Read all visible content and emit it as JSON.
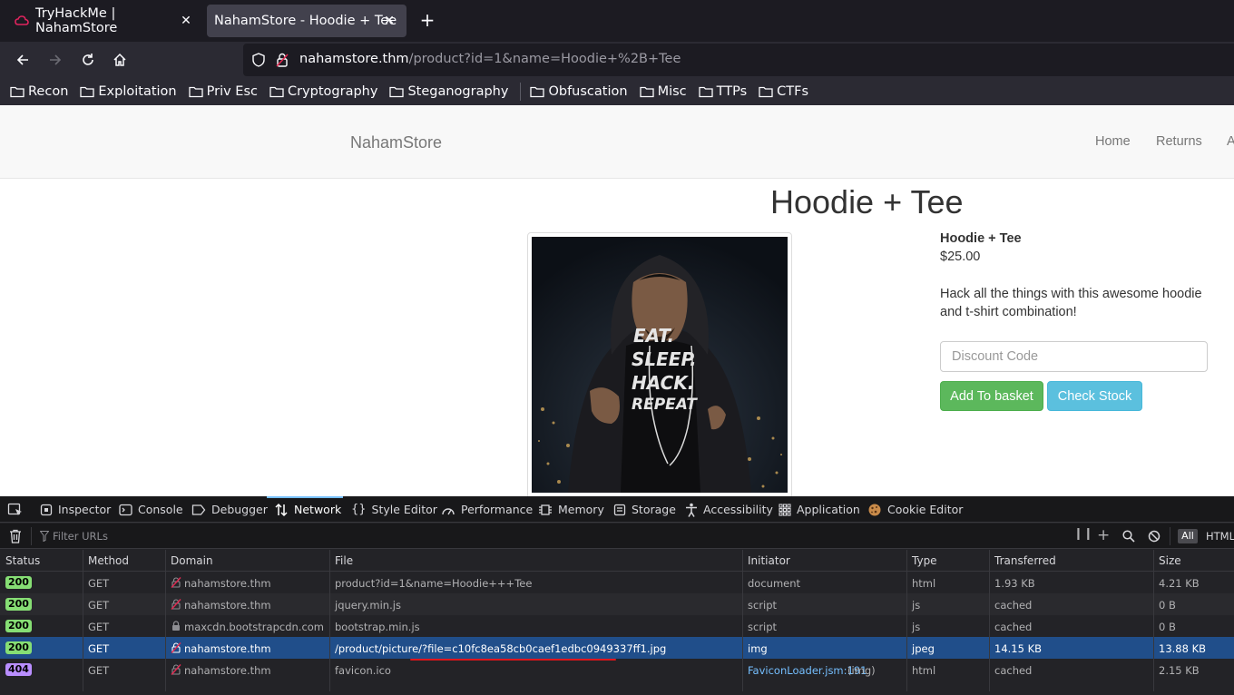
{
  "browser": {
    "tabs": [
      {
        "title": "TryHackMe | NahamStore",
        "active": false
      },
      {
        "title": "NahamStore - Hoodie + Tee",
        "active": true
      }
    ],
    "url": {
      "host": "nahamstore.thm",
      "path": "/product?id=1&name=Hoodie+%2B+Tee"
    },
    "bookmarks": [
      "Recon",
      "Exploitation",
      "Priv Esc",
      "Cryptography",
      "Steganography",
      "Obfuscation",
      "Misc",
      "TTPs",
      "CTFs"
    ]
  },
  "site": {
    "brand": "NahamStore",
    "nav": [
      "Home",
      "Returns",
      "A"
    ],
    "product": {
      "heading": "Hoodie + Tee",
      "name": "Hoodie + Tee",
      "price": "$25.00",
      "description": "Hack all the things with this awesome hoodie and t-shirt combination!",
      "shirt_text": [
        "EAT.",
        "SLEEP.",
        "HACK.",
        "REPEAT"
      ],
      "discount_placeholder": "Discount Code",
      "add_button": "Add To basket",
      "stock_button": "Check Stock"
    }
  },
  "devtools": {
    "tabs": [
      "Inspector",
      "Console",
      "Debugger",
      "Network",
      "Style Editor",
      "Performance",
      "Memory",
      "Storage",
      "Accessibility",
      "Application",
      "Cookie Editor"
    ],
    "active_tab": "Network",
    "filter_placeholder": "Filter URLs",
    "filter_all": "All",
    "filter_html": "HTML",
    "columns": [
      "Status",
      "Method",
      "Domain",
      "File",
      "Initiator",
      "Type",
      "Transferred",
      "Size"
    ],
    "rows": [
      {
        "status": "200",
        "method": "GET",
        "domain": "nahamstore.thm",
        "file": "product?id=1&name=Hoodie+++Tee",
        "initiator": "document",
        "initiator_extra": "",
        "type": "html",
        "transferred": "1.93 KB",
        "size": "4.21 KB"
      },
      {
        "status": "200",
        "method": "GET",
        "domain": "nahamstore.thm",
        "file": "jquery.min.js",
        "initiator": "script",
        "initiator_extra": "",
        "type": "js",
        "transferred": "cached",
        "size": "0 B"
      },
      {
        "status": "200",
        "method": "GET",
        "domain": "maxcdn.bootstrapcdn.com",
        "file": "bootstrap.min.js",
        "initiator": "script",
        "initiator_extra": "",
        "type": "js",
        "transferred": "cached",
        "size": "0 B"
      },
      {
        "status": "200",
        "method": "GET",
        "domain": "nahamstore.thm",
        "file": "/product/picture/?file=c10fc8ea58cb0caef1edbc0949337ff1.jpg",
        "initiator": "img",
        "initiator_extra": "",
        "type": "jpeg",
        "transferred": "14.15 KB",
        "size": "13.88 KB"
      },
      {
        "status": "404",
        "method": "GET",
        "domain": "nahamstore.thm",
        "file": "favicon.ico",
        "initiator": "FaviconLoader.jsm:191",
        "initiator_extra": " (img)",
        "type": "html",
        "transferred": "cached",
        "size": "2.15 KB"
      }
    ]
  },
  "colors": {
    "accent": "#75bfff",
    "selected_row": "#204e8a",
    "ok_status": "#86de74",
    "error_status": "#b98eff",
    "success_btn": "#5cb85c",
    "info_btn": "#5bc0de",
    "highlight": "#e0161c"
  }
}
